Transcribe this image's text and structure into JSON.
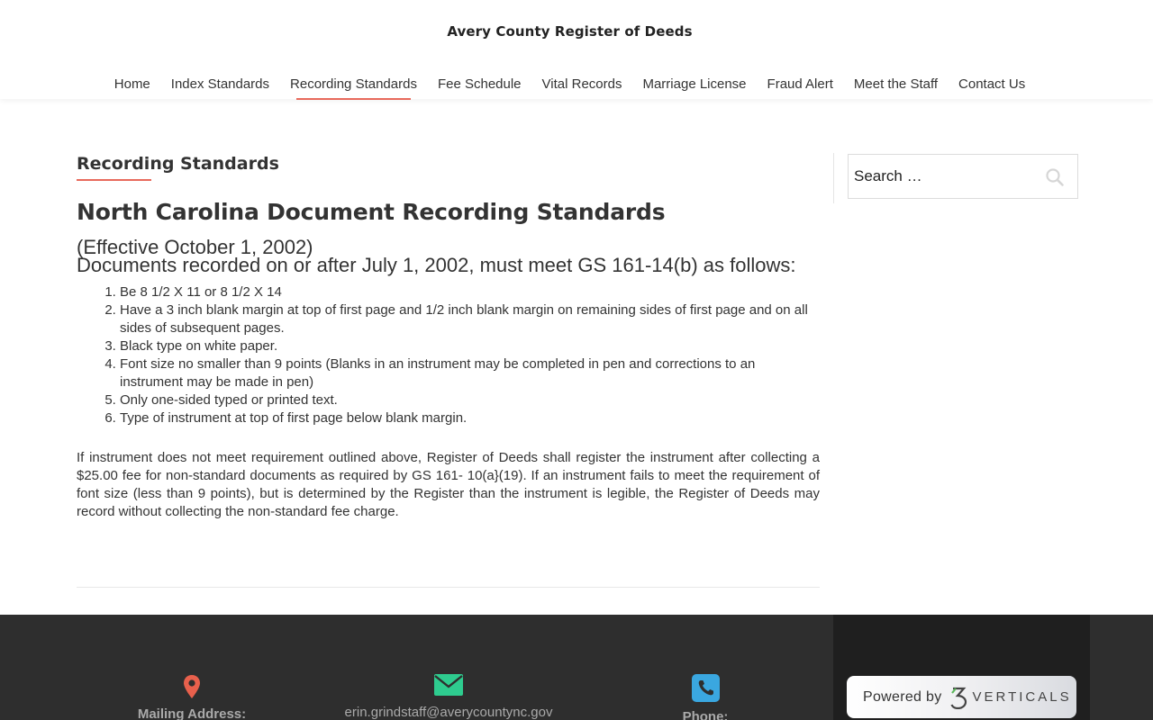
{
  "site": {
    "title": "Avery County Register of Deeds"
  },
  "nav": {
    "items": [
      {
        "label": "Home"
      },
      {
        "label": "Index Standards"
      },
      {
        "label": "Recording Standards"
      },
      {
        "label": "Fee Schedule"
      },
      {
        "label": "Vital Records"
      },
      {
        "label": "Marriage License"
      },
      {
        "label": "Fraud Alert"
      },
      {
        "label": "Meet the Staff"
      },
      {
        "label": "Contact Us"
      }
    ],
    "active": "Recording Standards"
  },
  "page": {
    "title": "Recording Standards",
    "heading": "North Carolina Document Recording Standards",
    "effective": "(Effective October 1, 2002)",
    "subhead": "Documents recorded on or after July 1, 2002, must meet GS 161-14(b) as follows:",
    "rules": [
      "Be 8 1/2 X 11 or 8 1/2 X 14",
      "Have a 3 inch blank margin at top of first page and 1/2 inch blank margin on remaining sides of first page and on all sides of subsequent pages.",
      "Black type on white paper.",
      "Font size no smaller than 9 points (Blanks in an instrument may be completed in pen and corrections to an instrument may be made in pen)",
      "Only one-sided typed or printed text.",
      "Type of instrument at top of first page below blank margin."
    ],
    "paragraph": "If instrument does not meet requirement outlined above, Register of Deeds shall register the instrument after collecting a $25.00 fee for non-standard documents as required by GS 161- 10(a}(19). If an instrument fails to meet the requirement of font size (less than 9 points), but is determined by the Register than the instrument is legible, the Register of Deeds may record without collecting the non-standard fee charge."
  },
  "sidebar": {
    "search": {
      "placeholder": "Search …",
      "icon": "search-icon"
    }
  },
  "footer": {
    "mailing_label": "Mailing Address:",
    "email": "erin.grindstaff@averycountync.gov",
    "phone_label": "Phone:",
    "powered_by": "Powered by",
    "brand": "VERTICALS",
    "colors": {
      "map_pin": "#e8604c",
      "email": "#2ecc8f",
      "phone": "#3aa7e0"
    }
  },
  "colors": {
    "accent": "#e86a5c",
    "footer_bg": "#2e2e2e"
  }
}
